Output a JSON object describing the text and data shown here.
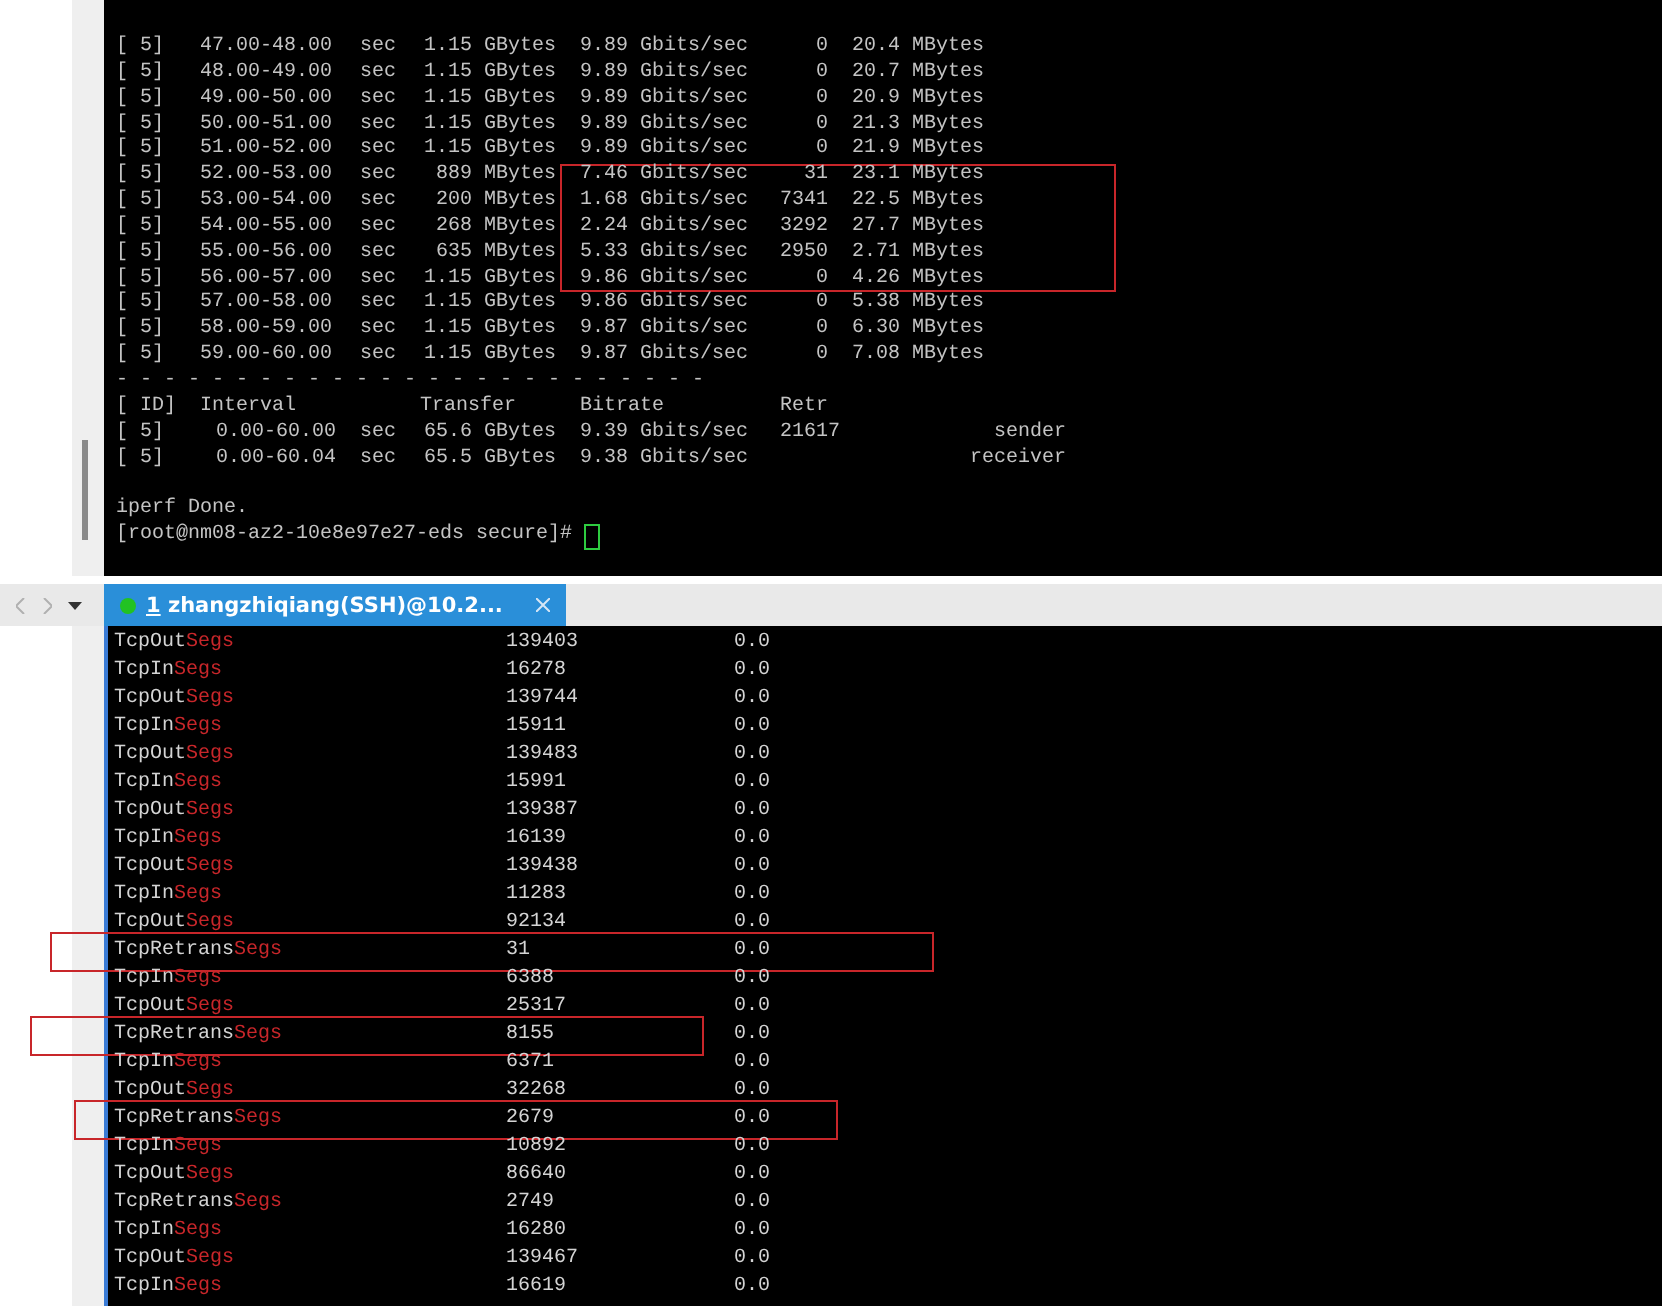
{
  "top_terminal": {
    "rows": [
      {
        "id": "[  5]",
        "interval": "47.00-48.00",
        "unit": "sec",
        "transfer": "1.15 GBytes",
        "bitrate": "9.89 Gbits/sec",
        "retr": "0",
        "cwnd": "20.4 MBytes",
        "highlighted": false
      },
      {
        "id": "[  5]",
        "interval": "48.00-49.00",
        "unit": "sec",
        "transfer": "1.15 GBytes",
        "bitrate": "9.89 Gbits/sec",
        "retr": "0",
        "cwnd": "20.7 MBytes",
        "highlighted": false
      },
      {
        "id": "[  5]",
        "interval": "49.00-50.00",
        "unit": "sec",
        "transfer": "1.15 GBytes",
        "bitrate": "9.89 Gbits/sec",
        "retr": "0",
        "cwnd": "20.9 MBytes",
        "highlighted": false
      },
      {
        "id": "[  5]",
        "interval": "50.00-51.00",
        "unit": "sec",
        "transfer": "1.15 GBytes",
        "bitrate": "9.89 Gbits/sec",
        "retr": "0",
        "cwnd": "21.3 MBytes",
        "highlighted": false
      },
      {
        "id": "[  5]",
        "interval": "51.00-52.00",
        "unit": "sec",
        "transfer": "1.15 GBytes",
        "bitrate": "9.89 Gbits/sec",
        "retr": "0",
        "cwnd": "21.9 MBytes",
        "highlighted": false
      },
      {
        "id": "[  5]",
        "interval": "52.00-53.00",
        "unit": "sec",
        "transfer": "889 MBytes",
        "bitrate": "7.46 Gbits/sec",
        "retr": "31",
        "cwnd": "23.1 MBytes",
        "highlighted": true
      },
      {
        "id": "[  5]",
        "interval": "53.00-54.00",
        "unit": "sec",
        "transfer": "200 MBytes",
        "bitrate": "1.68 Gbits/sec",
        "retr": "7341",
        "cwnd": "22.5 MBytes",
        "highlighted": true
      },
      {
        "id": "[  5]",
        "interval": "54.00-55.00",
        "unit": "sec",
        "transfer": "268 MBytes",
        "bitrate": "2.24 Gbits/sec",
        "retr": "3292",
        "cwnd": "27.7 MBytes",
        "highlighted": true
      },
      {
        "id": "[  5]",
        "interval": "55.00-56.00",
        "unit": "sec",
        "transfer": "635 MBytes",
        "bitrate": "5.33 Gbits/sec",
        "retr": "2950",
        "cwnd": "2.71 MBytes",
        "highlighted": true
      },
      {
        "id": "[  5]",
        "interval": "56.00-57.00",
        "unit": "sec",
        "transfer": "1.15 GBytes",
        "bitrate": "9.86 Gbits/sec",
        "retr": "0",
        "cwnd": "4.26 MBytes",
        "highlighted": true
      },
      {
        "id": "[  5]",
        "interval": "57.00-58.00",
        "unit": "sec",
        "transfer": "1.15 GBytes",
        "bitrate": "9.86 Gbits/sec",
        "retr": "0",
        "cwnd": "5.38 MBytes",
        "highlighted": false
      },
      {
        "id": "[  5]",
        "interval": "58.00-59.00",
        "unit": "sec",
        "transfer": "1.15 GBytes",
        "bitrate": "9.87 Gbits/sec",
        "retr": "0",
        "cwnd": "6.30 MBytes",
        "highlighted": false
      },
      {
        "id": "[  5]",
        "interval": "59.00-60.00",
        "unit": "sec",
        "transfer": "1.15 GBytes",
        "bitrate": "9.87 Gbits/sec",
        "retr": "0",
        "cwnd": "7.08 MBytes",
        "highlighted": false
      }
    ],
    "separator": "- - - - - - - - - - - - - - - - - - - - - - - - -",
    "summary_header": {
      "id": "[ ID]",
      "interval": "Interval",
      "transfer": "Transfer",
      "bitrate": "Bitrate",
      "retr": "Retr"
    },
    "summary_rows": [
      {
        "id": "[  5]",
        "interval": "0.00-60.00",
        "unit": "sec",
        "transfer": "65.6 GBytes",
        "bitrate": "9.39 Gbits/sec",
        "retr": "21617",
        "role": "sender"
      },
      {
        "id": "[  5]",
        "interval": "0.00-60.04",
        "unit": "sec",
        "transfer": "65.5 GBytes",
        "bitrate": "9.38 Gbits/sec",
        "role": "receiver"
      }
    ],
    "done_message": "iperf Done.",
    "prompt": "[root@nm08-az2-10e8e97e27-eds secure]#"
  },
  "tabs": [
    {
      "number": "1",
      "label": "zhangzhiqiang(SSH)@10.2...",
      "selected": true,
      "connected": true
    }
  ],
  "bottom_terminal": {
    "rows": [
      {
        "name": "TcpOut",
        "suffix": "Segs",
        "value": "139403",
        "rate": "0.0",
        "highlighted": false
      },
      {
        "name": "TcpIn",
        "suffix": "Segs",
        "value": "16278",
        "rate": "0.0",
        "highlighted": false
      },
      {
        "name": "TcpOut",
        "suffix": "Segs",
        "value": "139744",
        "rate": "0.0",
        "highlighted": false
      },
      {
        "name": "TcpIn",
        "suffix": "Segs",
        "value": "15911",
        "rate": "0.0",
        "highlighted": false
      },
      {
        "name": "TcpOut",
        "suffix": "Segs",
        "value": "139483",
        "rate": "0.0",
        "highlighted": false
      },
      {
        "name": "TcpIn",
        "suffix": "Segs",
        "value": "15991",
        "rate": "0.0",
        "highlighted": false
      },
      {
        "name": "TcpOut",
        "suffix": "Segs",
        "value": "139387",
        "rate": "0.0",
        "highlighted": false
      },
      {
        "name": "TcpIn",
        "suffix": "Segs",
        "value": "16139",
        "rate": "0.0",
        "highlighted": false
      },
      {
        "name": "TcpOut",
        "suffix": "Segs",
        "value": "139438",
        "rate": "0.0",
        "highlighted": false
      },
      {
        "name": "TcpIn",
        "suffix": "Segs",
        "value": "11283",
        "rate": "0.0",
        "highlighted": false
      },
      {
        "name": "TcpOut",
        "suffix": "Segs",
        "value": "92134",
        "rate": "0.0",
        "highlighted": false
      },
      {
        "name": "TcpRetrans",
        "suffix": "Segs",
        "value": "31",
        "rate": "0.0",
        "highlighted": true
      },
      {
        "name": "TcpIn",
        "suffix": "Segs",
        "value": "6388",
        "rate": "0.0",
        "highlighted": false
      },
      {
        "name": "TcpOut",
        "suffix": "Segs",
        "value": "25317",
        "rate": "0.0",
        "highlighted": false
      },
      {
        "name": "TcpRetrans",
        "suffix": "Segs",
        "value": "8155",
        "rate": "0.0",
        "highlighted": true
      },
      {
        "name": "TcpIn",
        "suffix": "Segs",
        "value": "6371",
        "rate": "0.0",
        "highlighted": false
      },
      {
        "name": "TcpOut",
        "suffix": "Segs",
        "value": "32268",
        "rate": "0.0",
        "highlighted": false
      },
      {
        "name": "TcpRetrans",
        "suffix": "Segs",
        "value": "2679",
        "rate": "0.0",
        "highlighted": true
      },
      {
        "name": "TcpIn",
        "suffix": "Segs",
        "value": "10892",
        "rate": "0.0",
        "highlighted": false
      },
      {
        "name": "TcpOut",
        "suffix": "Segs",
        "value": "86640",
        "rate": "0.0",
        "highlighted": false
      },
      {
        "name": "TcpRetrans",
        "suffix": "Segs",
        "value": "2749",
        "rate": "0.0",
        "highlighted": false
      },
      {
        "name": "TcpIn",
        "suffix": "Segs",
        "value": "16280",
        "rate": "0.0",
        "highlighted": false
      },
      {
        "name": "TcpOut",
        "suffix": "Segs",
        "value": "139467",
        "rate": "0.0",
        "highlighted": false
      },
      {
        "name": "TcpIn",
        "suffix": "Segs",
        "value": "16619",
        "rate": "0.0",
        "highlighted": false
      }
    ]
  }
}
